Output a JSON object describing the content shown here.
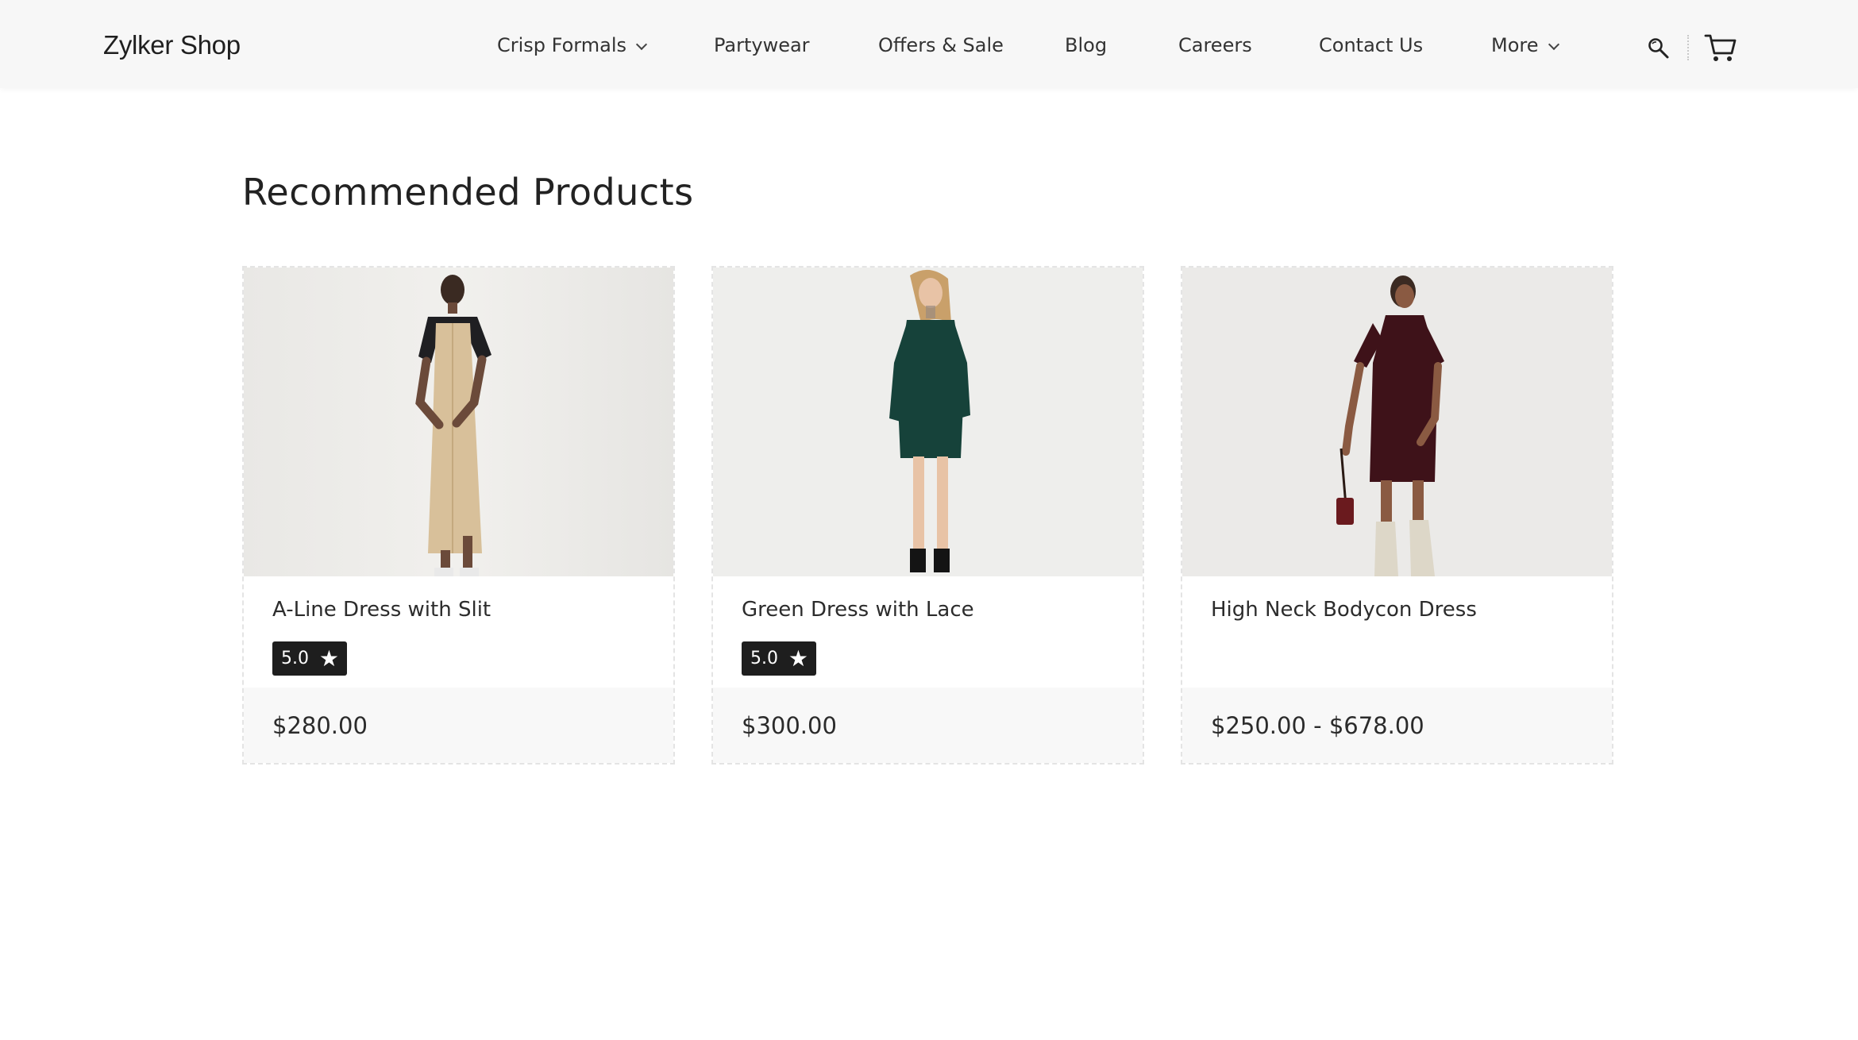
{
  "header": {
    "logo": "Zylker Shop",
    "nav": [
      {
        "label": "Crisp Formals",
        "has_dropdown": true
      },
      {
        "label": "Partywear",
        "has_dropdown": false
      },
      {
        "label": "Offers & Sale",
        "has_dropdown": false
      },
      {
        "label": "Blog",
        "has_dropdown": false
      },
      {
        "label": "Careers",
        "has_dropdown": false
      },
      {
        "label": "Contact Us",
        "has_dropdown": false
      },
      {
        "label": "More",
        "has_dropdown": true
      }
    ],
    "icons": [
      "search-icon",
      "cart-icon"
    ]
  },
  "section": {
    "title": "Recommended Products"
  },
  "products": [
    {
      "name": "A-Line Dress with Slit",
      "rating": "5.0",
      "price": "$280.00",
      "dress_color": "#d8c09a",
      "sleeve_color": "#1f1f22"
    },
    {
      "name": "Green Dress with Lace",
      "rating": "5.0",
      "price": "$300.00",
      "dress_color": "#16423a",
      "sleeve_color": "#16423a"
    },
    {
      "name": "High Neck Bodycon Dress",
      "rating": "",
      "price": "$250.00 - $678.00",
      "dress_color": "#3e1219",
      "sleeve_color": "#3e1219"
    }
  ],
  "colors": {
    "header_bg": "#f7f7f7",
    "rating_badge_bg": "#1e1e1e",
    "price_band_bg": "#f8f8f8",
    "image_bg": "#ececea"
  }
}
